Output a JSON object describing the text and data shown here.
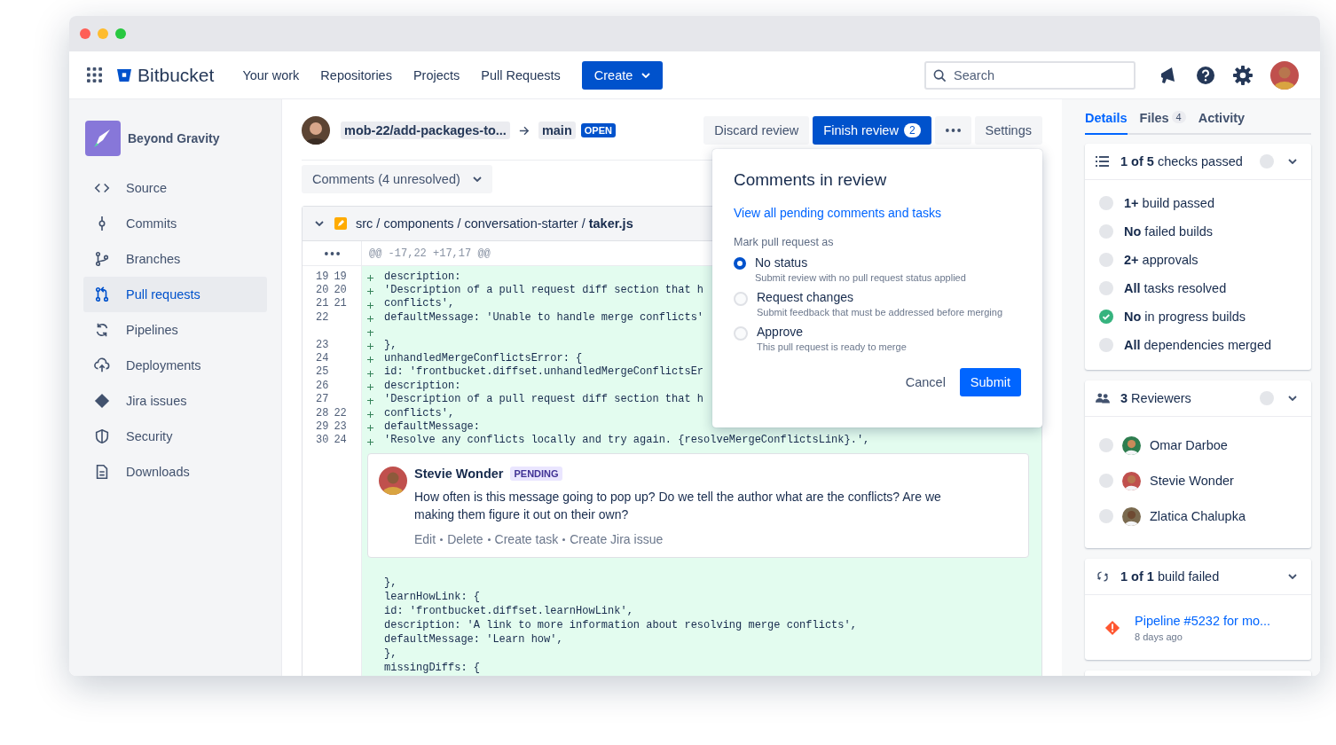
{
  "nav": {
    "logo": "Bitbucket",
    "links": [
      "Your work",
      "Repositories",
      "Projects",
      "Pull Requests"
    ],
    "create": "Create",
    "search": {
      "placeholder": "Search"
    }
  },
  "sidebar": {
    "project": "Beyond Gravity",
    "items": [
      {
        "label": "Source",
        "selected": false
      },
      {
        "label": "Commits",
        "selected": false
      },
      {
        "label": "Branches",
        "selected": false
      },
      {
        "label": "Pull requests",
        "selected": true
      },
      {
        "label": "Pipelines",
        "selected": false
      },
      {
        "label": "Deployments",
        "selected": false
      },
      {
        "label": "Jira issues",
        "selected": false
      },
      {
        "label": "Security",
        "selected": false
      },
      {
        "label": "Downloads",
        "selected": false
      }
    ]
  },
  "pull_request": {
    "branch": "mob-22/add-packages-to...",
    "target": "main",
    "status": "OPEN",
    "discard": "Discard review",
    "finish": "Finish review",
    "finish_count": "2",
    "settings": "Settings"
  },
  "comments_filter": "Comments (4 unresolved)",
  "file": {
    "path": "src / components / conversation-starter / **taker.js**",
    "hunk": "@@ -17,22 +17,17 @@",
    "lines": [
      {
        "old": "19",
        "new": "19",
        "added": true,
        "code": "description:"
      },
      {
        "old": "20",
        "new": "20",
        "added": true,
        "code": "'Description of a pull request diff section that h"
      },
      {
        "old": "21",
        "new": "21",
        "added": true,
        "code": "conflicts',"
      },
      {
        "old": "22",
        "added": true,
        "code": "defaultMessage: 'Unable to handle merge conflicts'"
      },
      {
        "added": true
      },
      {
        "old": "23",
        "added": true,
        "code": "},"
      },
      {
        "old": "24",
        "added": true,
        "code": "unhandledMergeConflictsError: {"
      },
      {
        "old": "25",
        "added": true,
        "code": "id: 'frontbucket.diffset.unhandledMergeConflictsEr"
      },
      {
        "old": "26",
        "added": true,
        "code": "description:"
      },
      {
        "old": "27",
        "added": true,
        "code": "'Description of a pull request diff section that h"
      },
      {
        "old": "28",
        "new": "22",
        "added": true,
        "code": "conflicts',"
      },
      {
        "old": "29",
        "new": "23",
        "added": true,
        "code": "defaultMessage:"
      },
      {
        "old": "30",
        "new": "24",
        "added": true,
        "code": "'Resolve any conflicts locally and try again. {resolveMergeConflictsLink}.',"
      }
    ],
    "comment": {
      "author": "Stevie Wonder",
      "status": "PENDING",
      "body": "How often is this message going to pop up? Do we tell the author what are the conflicts? Are we making them figure it out on their own?",
      "actions": [
        "Edit",
        "Delete",
        "Create task",
        "Create Jira issue"
      ]
    },
    "after_lines": [
      {
        "added": false,
        "code": "},"
      },
      {
        "added": false,
        "code": "learnHowLink: {"
      },
      {
        "added": false,
        "code": "id: 'frontbucket.diffset.learnHowLink',"
      },
      {
        "added": false,
        "code": "description: 'A link to more information about resolving merge conflicts',"
      },
      {
        "added": false,
        "code": "defaultMessage: 'Learn how',"
      },
      {
        "added": false,
        "code": "},"
      },
      {
        "added": false,
        "code": "missingDiffs: {"
      }
    ]
  },
  "review_popover": {
    "title": "Comments in review",
    "link": "View all pending comments and tasks",
    "label": "Mark pull request as",
    "options": [
      {
        "label": "No status",
        "description": "Submit review with no pull request status applied",
        "selected": true
      },
      {
        "label": "Request changes",
        "description": "Submit feedback that must be addressed before merging",
        "selected": false
      },
      {
        "label": "Approve",
        "description": "This pull request is ready to merge",
        "selected": false
      }
    ],
    "cancel": "Cancel",
    "submit": "Submit"
  },
  "details": {
    "tabs": [
      {
        "label": "Details",
        "selected": true
      },
      {
        "label": "Files",
        "count": "4",
        "selected": false
      },
      {
        "label": "Activity",
        "selected": false
      }
    ],
    "checks": {
      "title": "**1 of 5** checks passed",
      "items": [
        {
          "label": "**1+** build passed",
          "passed": false
        },
        {
          "label": "**No** failed builds",
          "passed": false
        },
        {
          "label": "**2+** approvals",
          "passed": false
        },
        {
          "label": "**All** tasks resolved",
          "passed": false
        },
        {
          "label": "**No** in progress builds",
          "passed": true
        },
        {
          "label": "**All** dependencies merged",
          "passed": false
        }
      ]
    },
    "reviewers": {
      "title": "**3** Reviewers",
      "people": [
        {
          "name": "Omar Darboe",
          "approved": false
        },
        {
          "name": "Stevie Wonder",
          "approved": false
        },
        {
          "name": "Zlatica Chalupka",
          "approved": false
        }
      ]
    },
    "builds": {
      "title": "**1 of 1** build failed",
      "items": [
        {
          "name": "Pipeline #5232 for mo...",
          "time": "8 days ago",
          "failed": true
        }
      ]
    }
  }
}
